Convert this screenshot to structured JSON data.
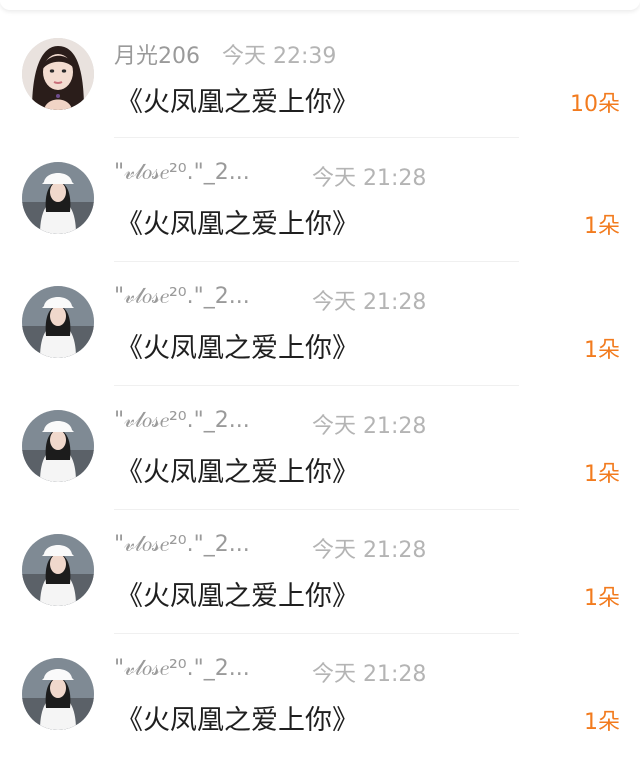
{
  "colors": {
    "accent_orange": "#f27b1e",
    "username_gray": "#9a9a9a",
    "time_gray": "#b4b4b4",
    "text_dark": "#1f1f1f"
  },
  "records": [
    {
      "avatar_icon": "avatar-woman-dark-hair",
      "username": "月光206",
      "timestamp": "今天 22:39",
      "gift": "《火凤凰之爱上你》",
      "count": "10朵"
    },
    {
      "avatar_icon": "avatar-woman-white-hat",
      "username": "\"𝓋𝓁𝑜𝓈𝑒²⁰.\"_2...",
      "timestamp": "今天 21:28",
      "gift": "《火凤凰之爱上你》",
      "count": "1朵"
    },
    {
      "avatar_icon": "avatar-woman-white-hat",
      "username": "\"𝓋𝓁𝑜𝓈𝑒²⁰.\"_2...",
      "timestamp": "今天 21:28",
      "gift": "《火凤凰之爱上你》",
      "count": "1朵"
    },
    {
      "avatar_icon": "avatar-woman-white-hat",
      "username": "\"𝓋𝓁𝑜𝓈𝑒²⁰.\"_2...",
      "timestamp": "今天 21:28",
      "gift": "《火凤凰之爱上你》",
      "count": "1朵"
    },
    {
      "avatar_icon": "avatar-woman-white-hat",
      "username": "\"𝓋𝓁𝑜𝓈𝑒²⁰.\"_2...",
      "timestamp": "今天 21:28",
      "gift": "《火凤凰之爱上你》",
      "count": "1朵"
    },
    {
      "avatar_icon": "avatar-woman-white-hat",
      "username": "\"𝓋𝓁𝑜𝓈𝑒²⁰.\"_2...",
      "timestamp": "今天 21:28",
      "gift": "《火凤凰之爱上你》",
      "count": "1朵"
    }
  ]
}
